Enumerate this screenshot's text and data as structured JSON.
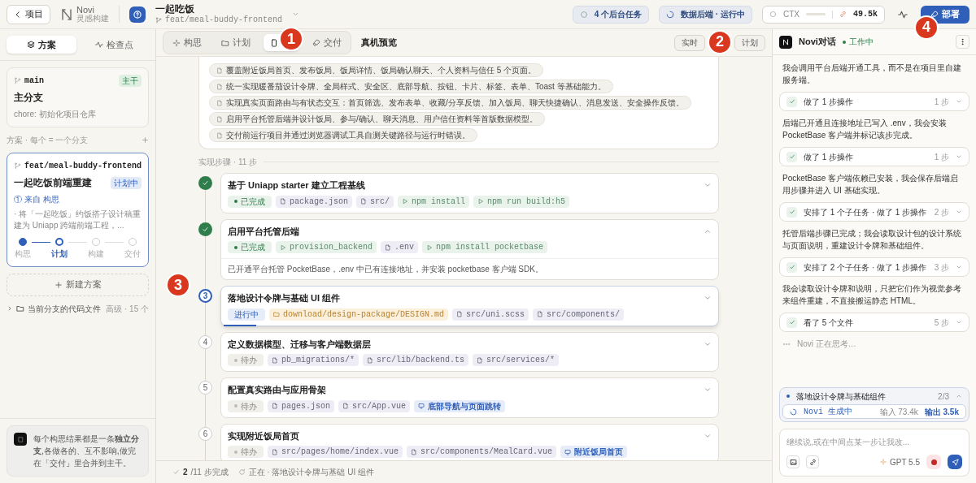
{
  "topbar": {
    "back": "项目",
    "logo": "Novi",
    "logo_sub": "灵感构建",
    "project": "一起吃饭",
    "branch": "feat/meal-buddy-frontend",
    "tasks": "4 个后台任务",
    "backend": "数据后端 · 运行中",
    "ctx": "CTX",
    "tokens": "49.5k",
    "deploy": "部署"
  },
  "sidebar": {
    "tabs": [
      {
        "label": "方案",
        "selected": true
      },
      {
        "label": "检查点",
        "selected": false
      }
    ],
    "main_card": {
      "branch": "main",
      "badge": "主干",
      "title": "主分支",
      "subtitle": "chore: 初始化项目仓库"
    },
    "section": "方案 · 每个 = 一个分支",
    "plan_card": {
      "branch": "feat/meal-buddy-frontend",
      "badge": "计划中",
      "title": "一起吃饭前端重建",
      "source": "① 来自 构思",
      "desc": "· 将「一起吃饭」约饭搭子设计稿重建为 Uniapp 跨端前端工程，...",
      "stages": [
        {
          "label": "构思",
          "kind": "done"
        },
        {
          "label": "计划",
          "kind": "current"
        },
        {
          "label": "构建",
          "kind": "todo"
        },
        {
          "label": "交付",
          "kind": "todo"
        }
      ]
    },
    "new_plan": "新建方案",
    "files": {
      "label": "当前分支的代码文件",
      "meta": "高级 · 15 个"
    },
    "tip": "每个构思结果都是一条**独立分支**,各做各的、互不影响,做完在「交付」里合并到主干。"
  },
  "center": {
    "tabs": [
      {
        "label": "构思",
        "selected": false
      },
      {
        "label": "计划",
        "selected": false
      },
      {
        "selected": true
      },
      {
        "label": "交付",
        "selected": false
      }
    ],
    "title": "真机预览",
    "actions": [
      "实时",
      "计划"
    ],
    "bullets": [
      "覆盖附近饭局首页、发布饭局、饭局详情、饭局确认聊天、个人资料与信任 5 个页面。",
      "统一实现暖番茄设计令牌、全局样式、安全区、底部导航、按钮、卡片、标签、表单、Toast 等基础能力。",
      "实现真实页面路由与有状态交互：首页筛选、发布表单、收藏/分享反馈、加入饭局、聊天快捷确认、消息发送、安全操作反馈。",
      "启用平台托管后端并设计饭局、参与/确认、聊天消息、用户信任资料等首版数据模型。",
      "交付前运行项目并通过浏览器调试工具自测关键路径与运行时错误。"
    ],
    "steps_label": "实现步骤 · 11 步",
    "steps": [
      {
        "kind": "done",
        "title": "基于 Uniapp starter 建立工程基线",
        "status": "已完成",
        "expanded": false,
        "chips": [
          {
            "kind": "file",
            "text": "package.json"
          },
          {
            "kind": "file",
            "text": "src/"
          },
          {
            "kind": "cmd",
            "text": "npm install"
          },
          {
            "kind": "cmd",
            "text": "npm run build:h5"
          }
        ]
      },
      {
        "kind": "done",
        "title": "启用平台托管后端",
        "status": "已完成",
        "expanded": true,
        "note": "已开通平台托管 PocketBase，.env 中已有连接地址，并安装 pocketbase 客户端 SDK。",
        "chips": [
          {
            "kind": "cmd",
            "text": "provision_backend"
          },
          {
            "kind": "file",
            "text": ".env"
          },
          {
            "kind": "cmd",
            "text": "npm install pocketbase"
          }
        ]
      },
      {
        "kind": "active",
        "number": "3",
        "title": "落地设计令牌与基础 UI 组件",
        "status": "进行中",
        "expanded": false,
        "chips": [
          {
            "kind": "folder",
            "text": "download/design-package/DESIGN.md"
          },
          {
            "kind": "file",
            "text": "src/uni.scss"
          },
          {
            "kind": "file",
            "text": "src/components/"
          }
        ]
      },
      {
        "kind": "todo",
        "number": "4",
        "title": "定义数据模型、迁移与客户端数据层",
        "status": "待办",
        "expanded": false,
        "chips": [
          {
            "kind": "file",
            "text": "pb_migrations/*"
          },
          {
            "kind": "file",
            "text": "src/lib/backend.ts"
          },
          {
            "kind": "file",
            "text": "src/services/*"
          }
        ]
      },
      {
        "kind": "todo",
        "number": "5",
        "title": "配置真实路由与应用骨架",
        "status": "待办",
        "expanded": false,
        "chips": [
          {
            "kind": "file",
            "text": "pages.json"
          },
          {
            "kind": "file",
            "text": "src/App.vue"
          },
          {
            "kind": "preview",
            "text": "底部导航与页面跳转"
          }
        ]
      },
      {
        "kind": "todo",
        "number": "6",
        "title": "实现附近饭局首页",
        "status": "待办",
        "expanded": false,
        "chips": [
          {
            "kind": "file",
            "text": "src/pages/home/index.vue"
          },
          {
            "kind": "file",
            "text": "src/components/MealCard.vue"
          },
          {
            "kind": "preview",
            "text": "附近饭局首页"
          }
        ]
      }
    ],
    "status_bar": {
      "done": "2",
      "total": "/11 步完成",
      "current": "正在 · 落地设计令牌与基础 UI 组件"
    }
  },
  "chat": {
    "title": "Novi对话",
    "state": "工作中",
    "messages": [
      {
        "kind": "text",
        "text": "我会调用平台后端开通工具，而不是在项目里自建服务端。"
      },
      {
        "kind": "action",
        "text": "做了 1 步操作",
        "count": "1 步"
      },
      {
        "kind": "text",
        "text": "后端已开通且连接地址已写入 .env，我会安装 PocketBase 客户端并标记该步完成。"
      },
      {
        "kind": "action",
        "text": "做了 1 步操作",
        "count": "1 步"
      },
      {
        "kind": "text",
        "text": "PocketBase 客户端依赖已安装，我会保存后端启用步骤并进入 UI 基础实现。"
      },
      {
        "kind": "action",
        "text": "安排了 1 个子任务 · 做了 1 步操作",
        "count": "2 步"
      },
      {
        "kind": "text",
        "text": "托管后端步骤已完成；我会读取设计包的设计系统与页面说明，重建设计令牌和基础组件。"
      },
      {
        "kind": "action",
        "text": "安排了 2 个子任务 · 做了 1 步操作",
        "count": "3 步"
      },
      {
        "kind": "text",
        "text": "我会读取设计令牌和说明，只把它们作为视觉参考来组件重建，不直接搬运静态 HTML。"
      },
      {
        "kind": "action",
        "text": "看了 5 个文件",
        "count": "5 步"
      },
      {
        "kind": "thinking",
        "text": "Novi 正在思考…"
      }
    ],
    "task": {
      "title": "落地设计令牌与基础组件",
      "count": "2/3",
      "state": "Novi 生成中",
      "input": "输入 73.4k",
      "output": "输出 3.5k"
    },
    "placeholder": "继续说,或在中间点某一步让我改...",
    "model": "GPT 5.5"
  },
  "annotations": [
    "1",
    "2",
    "3",
    "4"
  ]
}
